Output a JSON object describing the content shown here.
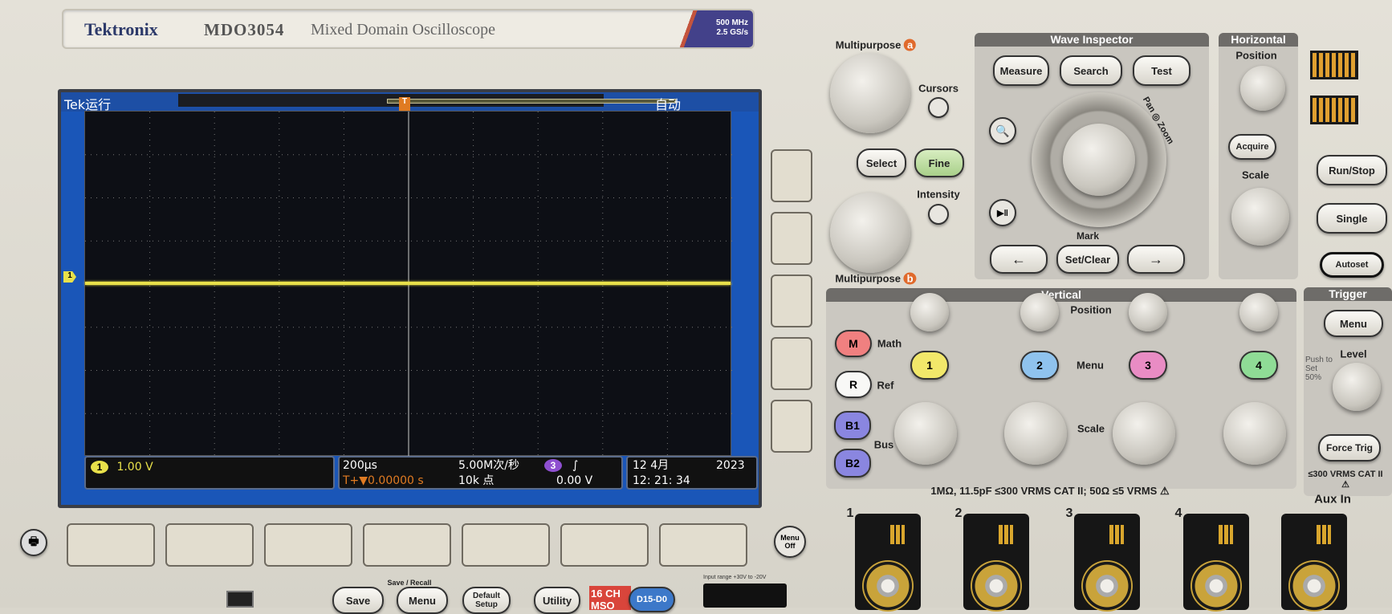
{
  "brand": {
    "logo": "Tektronix",
    "model": "MDO3054",
    "description": "Mixed Domain Oscilloscope",
    "bandwidth": "500 MHz",
    "sample_rate": "2.5 GS/s"
  },
  "screen": {
    "top": {
      "tek": "Tek",
      "run_state": "运行",
      "trigger_mode": "自动"
    },
    "trigger_marker": "T",
    "ch1_marker": "1",
    "trace_color": "#e8e04a",
    "status": {
      "ch1_badge": "1",
      "ch1_scale": "1.00 V",
      "timebase": "200µs",
      "sample_rate": "5.00M次/秒",
      "trigger_offset": "T+▼0.00000 s",
      "record_length": "10k 点",
      "trigger_source_badge": "3",
      "trigger_slope": "∫",
      "trigger_level": "0.00 V",
      "date": "12 4月",
      "year": "2023",
      "time": "12: 21: 34"
    }
  },
  "front_panel": {
    "menu_off": "Menu Off",
    "multipurpose_a": "Multipurpose",
    "a": "a",
    "multipurpose_b": "Multipurpose",
    "b": "b",
    "cursors": "Cursors",
    "select": "Select",
    "fine": "Fine",
    "intensity": "Intensity",
    "wave_inspector": {
      "title": "Wave Inspector",
      "measure": "Measure",
      "search": "Search",
      "test": "Test",
      "pan_zoom": "Pan ◎ Zoom",
      "mark": "Mark",
      "prev": "←",
      "set_clear": "Set/Clear",
      "next": "→"
    },
    "horizontal": {
      "title": "Horizontal",
      "position": "Position",
      "acquire": "Acquire",
      "scale": "Scale"
    },
    "run_stop": "Run/Stop",
    "single": "Single",
    "autoset": "Autoset",
    "vertical": {
      "title": "Vertical",
      "position": "Position",
      "menu": "Menu",
      "scale": "Scale",
      "math_btn": "M",
      "math": "Math",
      "ref_btn": "R",
      "ref": "Ref",
      "b1": "B1",
      "b2": "B2",
      "bus": "Bus",
      "channels": [
        {
          "label": "1",
          "color": "#f2e86a"
        },
        {
          "label": "2",
          "color": "#8fc3ee"
        },
        {
          "label": "3",
          "color": "#e98cc4"
        },
        {
          "label": "4",
          "color": "#8fdc96"
        }
      ],
      "input_spec": "1MΩ, 11.5pF ≤300 VRMS CAT II; 50Ω ≤5 VRMS ⚠"
    },
    "trigger": {
      "title": "Trigger",
      "menu": "Menu",
      "level": "Level",
      "push_to_set": "Push to Set 50%",
      "force_trig": "Force Trig",
      "aux_rating": "≤300 VRMS CAT II ⚠",
      "aux_in": "Aux In"
    },
    "save_recall": {
      "title": "Save / Recall",
      "save": "Save",
      "menu": "Menu",
      "default_setup": "Default Setup"
    },
    "utility": "Utility",
    "mso_badge": "16 CH MSO",
    "digital": "D15-D0",
    "input_range": "Input range +30V to -20V"
  }
}
